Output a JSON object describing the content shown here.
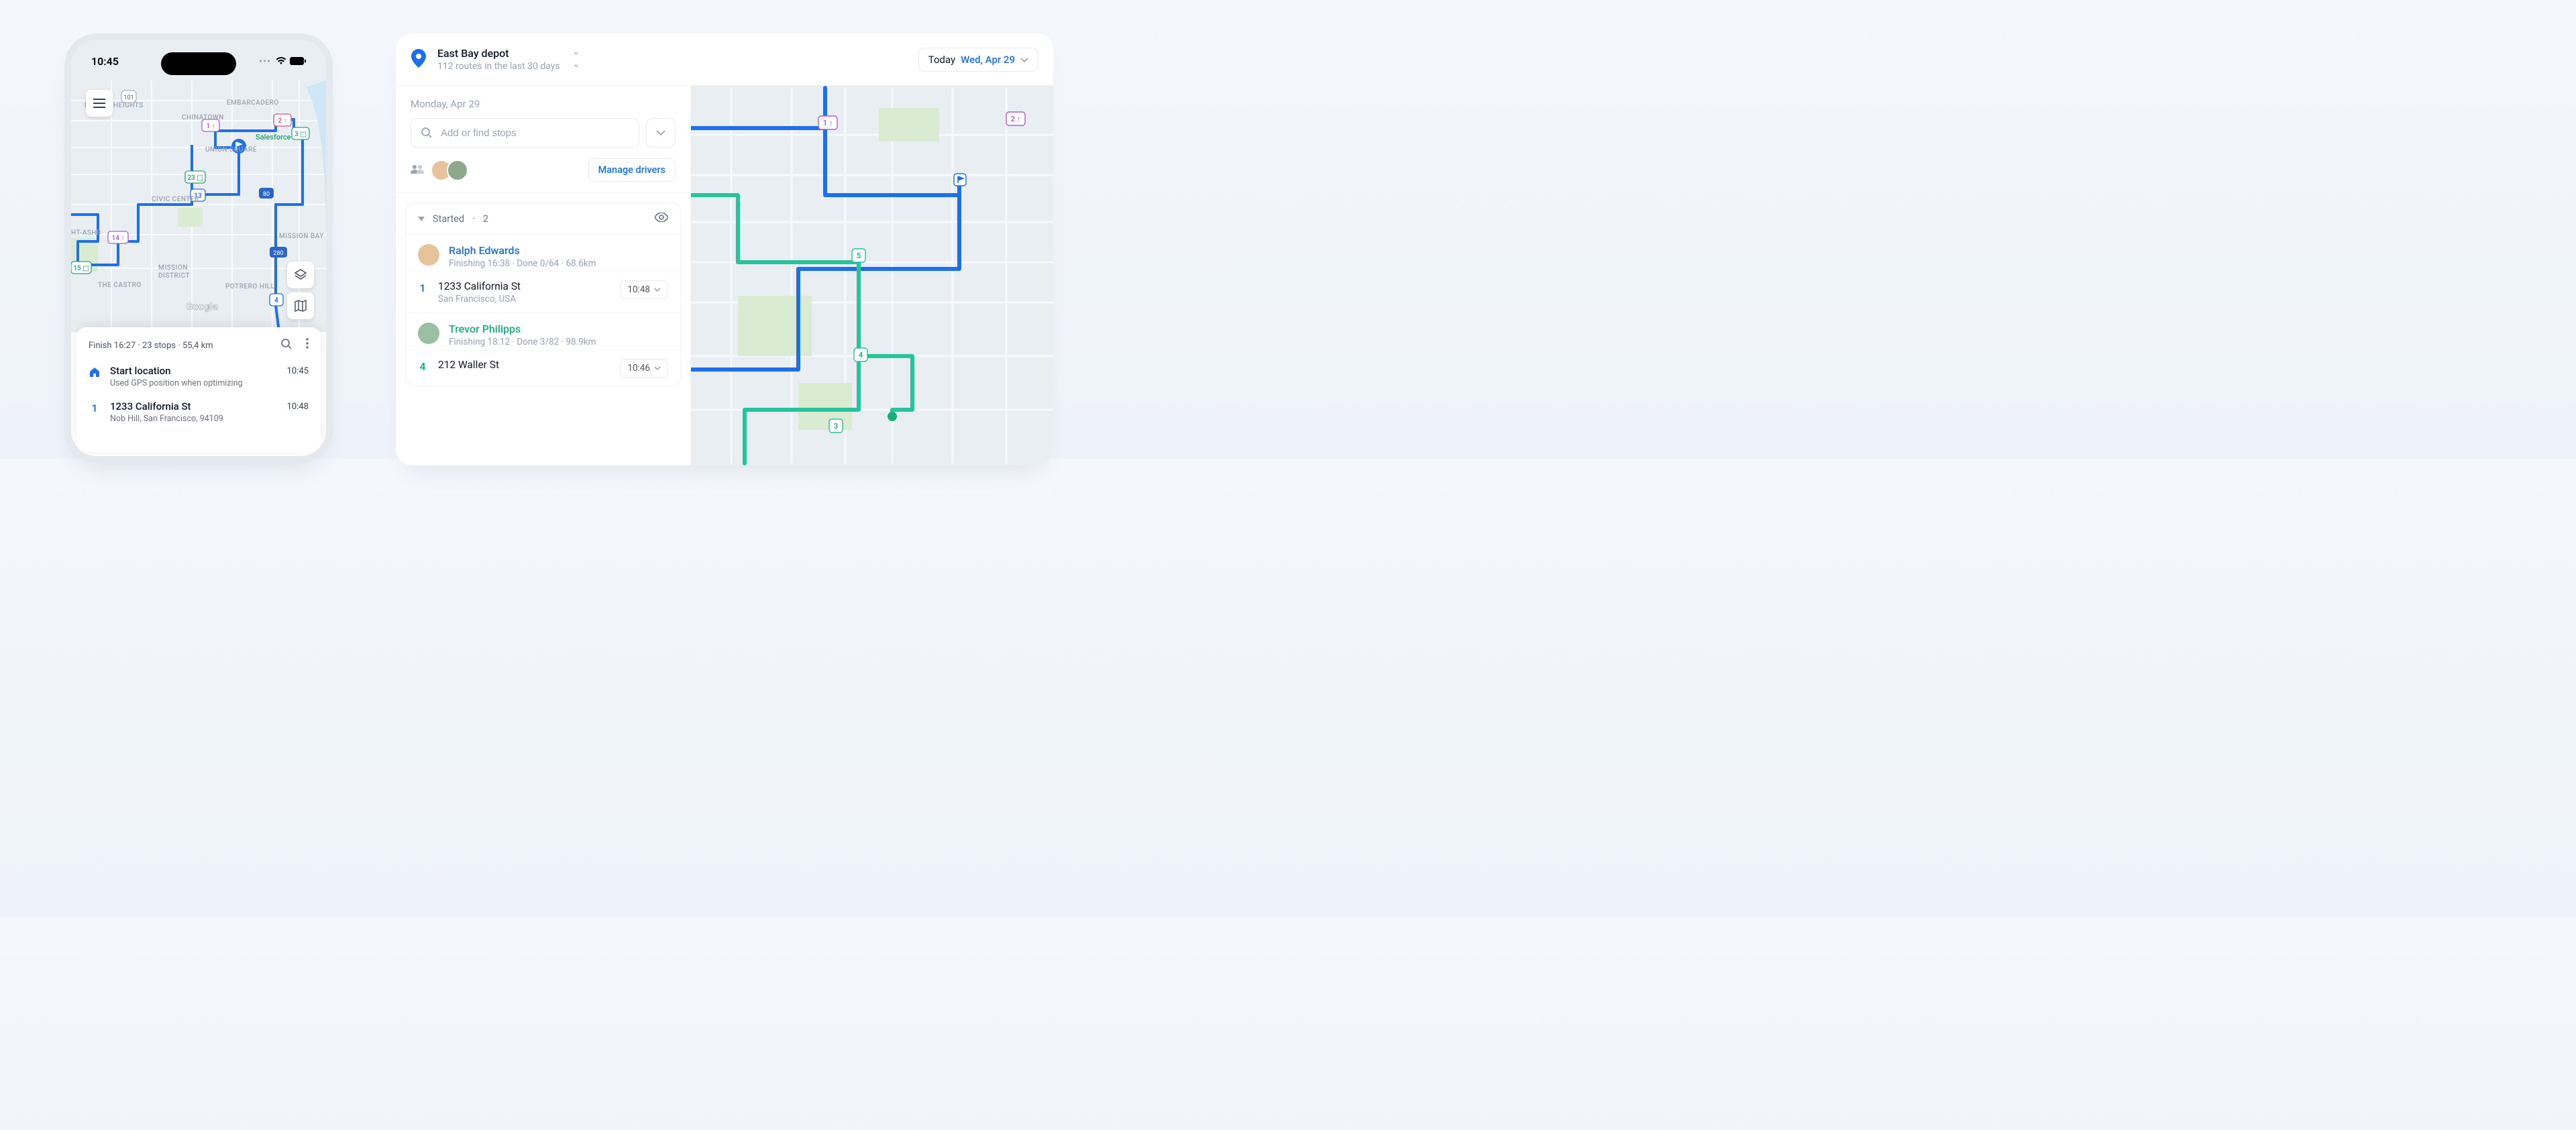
{
  "phone": {
    "clock": "10:45",
    "sheet": {
      "summary": "Finish 16:27 · 23 stops · 55,4 km",
      "start": {
        "title": "Start location",
        "sub": "Used GPS position when optimizing",
        "time": "10:45"
      },
      "stop1": {
        "num": "1",
        "title": "1233 California St",
        "sub": "Nob Hill, San Francisco, 94109",
        "time": "10:48"
      }
    },
    "map_pins": {
      "p1": "1 ↑",
      "p2": "2 ↑",
      "p3": "3 ⬚",
      "p13": "13",
      "p15": "15 ⬚",
      "p14": "14 ↑",
      "p23": "23 ⬚",
      "p4": "4"
    },
    "neighborhoods": {
      "pacific": "PACIFIC HEIGHTS",
      "embarcadero": "EMBARCADERO",
      "chinatown": "CHINATOWN",
      "union": "UNION SQUARE",
      "civic": "CIVIC CENTER",
      "ashbury": "HT-ASHB",
      "mission_district": "MISSION\nDISTRICT",
      "mission_bay": "MISSION BAY",
      "castro": "THE CASTRO",
      "potrero": "POTRERO HILL",
      "salesforce": "Salesforce"
    },
    "google": "Google"
  },
  "desktop": {
    "depot_name": "East Bay depot",
    "depot_sub": "112 routes in the last 30 days",
    "date_label": "Today",
    "date_value": "Wed, Apr 29",
    "side_date": "Monday, Apr 29",
    "search_placeholder": "Add or find stops",
    "manage_label": "Manage drivers",
    "card": {
      "status": "Started",
      "count": "2"
    },
    "drivers": {
      "ralph": {
        "name": "Ralph Edwards",
        "meta": "Finishing 16:38  ·  Done 0/64  ·  68.6km",
        "stop_num": "1",
        "stop_addr": "1233 California St",
        "stop_city": "San Francisco, USA",
        "stop_time": "10:48"
      },
      "trevor": {
        "name": "Trevor Philipps",
        "meta": "Finishing 18:12  ·  Done 3/82  ·  98.9km",
        "stop_num": "4",
        "stop_addr": "212 Waller St",
        "stop_time": "10:46"
      }
    },
    "map_pins": {
      "p1": "1 ↑",
      "p2": "2 ↑",
      "p5": "5",
      "p4": "4",
      "p3": "3"
    }
  }
}
